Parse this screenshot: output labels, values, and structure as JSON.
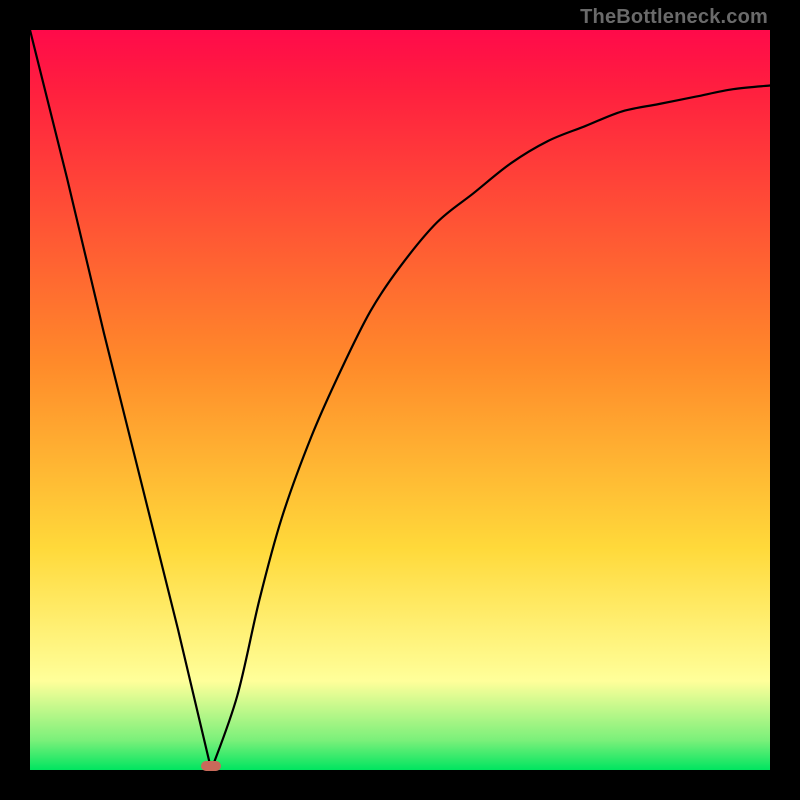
{
  "watermark": "TheBottleneck.com",
  "colors": {
    "top": "#ff0a4a",
    "red": "#ff1f3f",
    "orange": "#ff8a2a",
    "yellow": "#ffd93a",
    "paleyellow": "#ffff9a",
    "lightgreen": "#7af07a",
    "green": "#00e560",
    "curve": "#000000",
    "marker": "#c96a5a"
  },
  "chart_data": {
    "type": "line",
    "title": "",
    "xlabel": "",
    "ylabel": "",
    "xlim": [
      0,
      1
    ],
    "ylim": [
      0,
      1
    ],
    "annotations": [
      "TheBottleneck.com"
    ],
    "x": [
      0.0,
      0.05,
      0.1,
      0.15,
      0.2,
      0.245,
      0.28,
      0.31,
      0.34,
      0.38,
      0.42,
      0.46,
      0.5,
      0.55,
      0.6,
      0.65,
      0.7,
      0.75,
      0.8,
      0.85,
      0.9,
      0.95,
      1.0
    ],
    "y": [
      1.0,
      0.8,
      0.59,
      0.39,
      0.19,
      0.0,
      0.1,
      0.23,
      0.34,
      0.45,
      0.54,
      0.62,
      0.68,
      0.74,
      0.78,
      0.82,
      0.85,
      0.87,
      0.89,
      0.9,
      0.91,
      0.92,
      0.925
    ],
    "marker": {
      "x": 0.245,
      "y": 0.006
    },
    "legend": null,
    "grid": false
  }
}
